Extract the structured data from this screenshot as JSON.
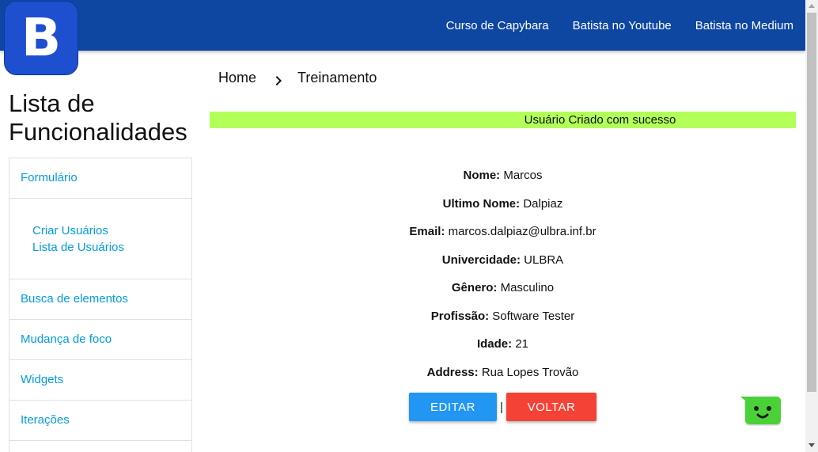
{
  "navbar": {
    "background": "#0d47a1",
    "links": [
      {
        "label": "Curso de Capybara"
      },
      {
        "label": "Batista no Youtube"
      },
      {
        "label": "Batista no Medium"
      }
    ]
  },
  "logo": {
    "letter": "B",
    "color": "#1e4fcf"
  },
  "sidebar": {
    "title": "Lista de Funcionalidades",
    "items": [
      {
        "label": "Formulário"
      },
      {
        "label": "Busca de elementos"
      },
      {
        "label": "Mudança de foco"
      },
      {
        "label": "Widgets"
      },
      {
        "label": "Iterações"
      }
    ],
    "sub_items": [
      {
        "label": "Criar Usuários"
      },
      {
        "label": "Lista de Usuários"
      }
    ]
  },
  "breadcrumb": {
    "home": "Home",
    "current": "Treinamento"
  },
  "alert": {
    "message": "Usuário Criado com sucesso",
    "color": "#b2ff59"
  },
  "user": {
    "fields": [
      {
        "label": "Nome:",
        "value": "Marcos"
      },
      {
        "label": "Ultimo Nome:",
        "value": "Dalpiaz"
      },
      {
        "label": "Email:",
        "value": "marcos.dalpiaz@ulbra.inf.br"
      },
      {
        "label": "Univercidade:",
        "value": "ULBRA"
      },
      {
        "label": "Gênero:",
        "value": "Masculino"
      },
      {
        "label": "Profissão:",
        "value": "Software Tester"
      },
      {
        "label": "Idade:",
        "value": "21"
      },
      {
        "label": "Address:",
        "value": "Rua Lopes Trovão"
      }
    ]
  },
  "actions": {
    "edit_label": "EDITAR",
    "separator": "|",
    "back_label": "VOLTAR",
    "edit_color": "#2196f3",
    "back_color": "#f44336"
  },
  "chatbot": {
    "icon": "chatbot-face-icon",
    "color": "#4cd137"
  }
}
